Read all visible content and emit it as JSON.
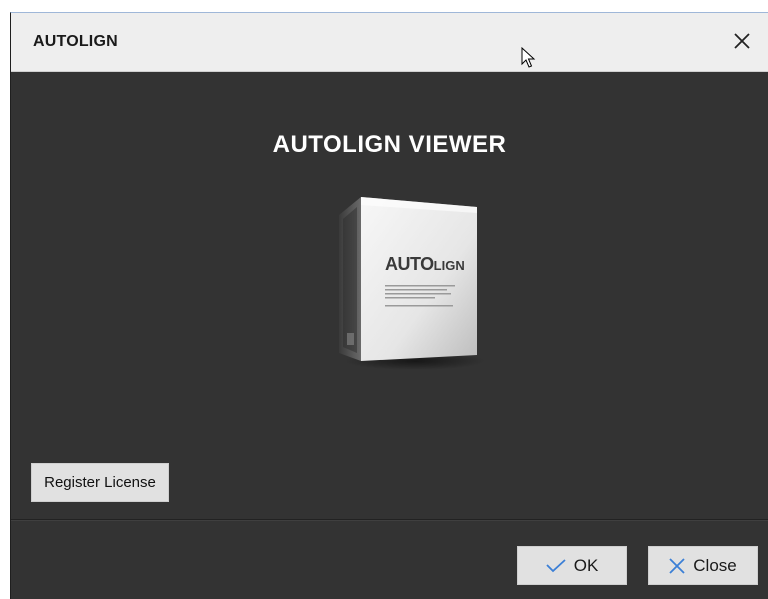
{
  "window": {
    "title": "AUTOLIGN",
    "close_icon": "close-icon"
  },
  "main": {
    "heading": "AUTOLIGN VIEWER",
    "product_box": {
      "brand_prefix": "AUTO",
      "brand_suffix": "LIGN"
    }
  },
  "buttons": {
    "register_license": "Register License",
    "ok": "OK",
    "close": "Close"
  },
  "colors": {
    "background": "#333333",
    "titlebar": "#eeeeee",
    "button": "#e1e1e1",
    "accent_icon": "#3b7fd6"
  }
}
